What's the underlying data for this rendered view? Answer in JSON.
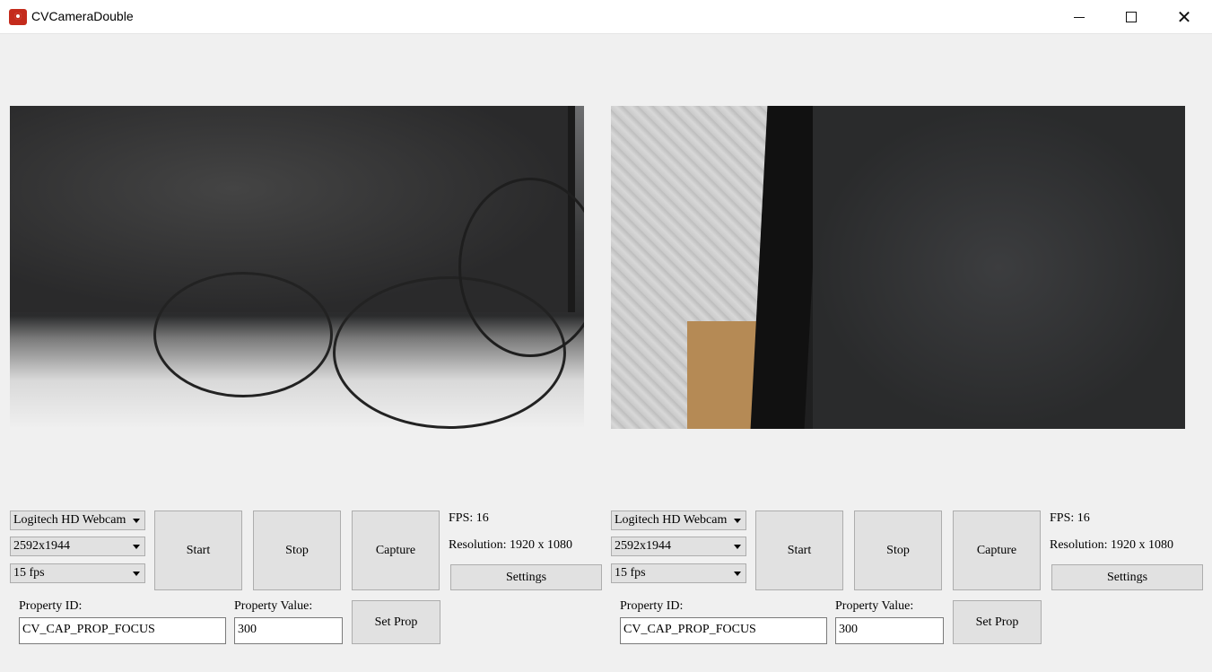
{
  "window": {
    "title": "CVCameraDouble",
    "minimize_icon": "minimize-icon",
    "maximize_icon": "maximize-icon",
    "close_icon": "close-icon",
    "close_glyph": "✕"
  },
  "panels": [
    {
      "device": "Logitech HD Webcam",
      "resolution_option": "2592x1944",
      "fps_option": "15 fps",
      "start_label": "Start",
      "stop_label": "Stop",
      "capture_label": "Capture",
      "fps_text": "FPS: 16",
      "resolution_text": "Resolution: 1920 x 1080",
      "settings_label": "Settings",
      "property_id_label": "Property ID:",
      "property_id_value": "CV_CAP_PROP_FOCUS",
      "property_value_label": "Property Value:",
      "property_value_value": "300",
      "set_prop_label": "Set Prop"
    },
    {
      "device": "Logitech HD Webcam",
      "resolution_option": "2592x1944",
      "fps_option": "15 fps",
      "start_label": "Start",
      "stop_label": "Stop",
      "capture_label": "Capture",
      "fps_text": "FPS: 16",
      "resolution_text": "Resolution: 1920 x 1080",
      "settings_label": "Settings",
      "property_id_label": "Property ID:",
      "property_id_value": "CV_CAP_PROP_FOCUS",
      "property_value_label": "Property Value:",
      "property_value_value": "300",
      "set_prop_label": "Set Prop"
    }
  ]
}
